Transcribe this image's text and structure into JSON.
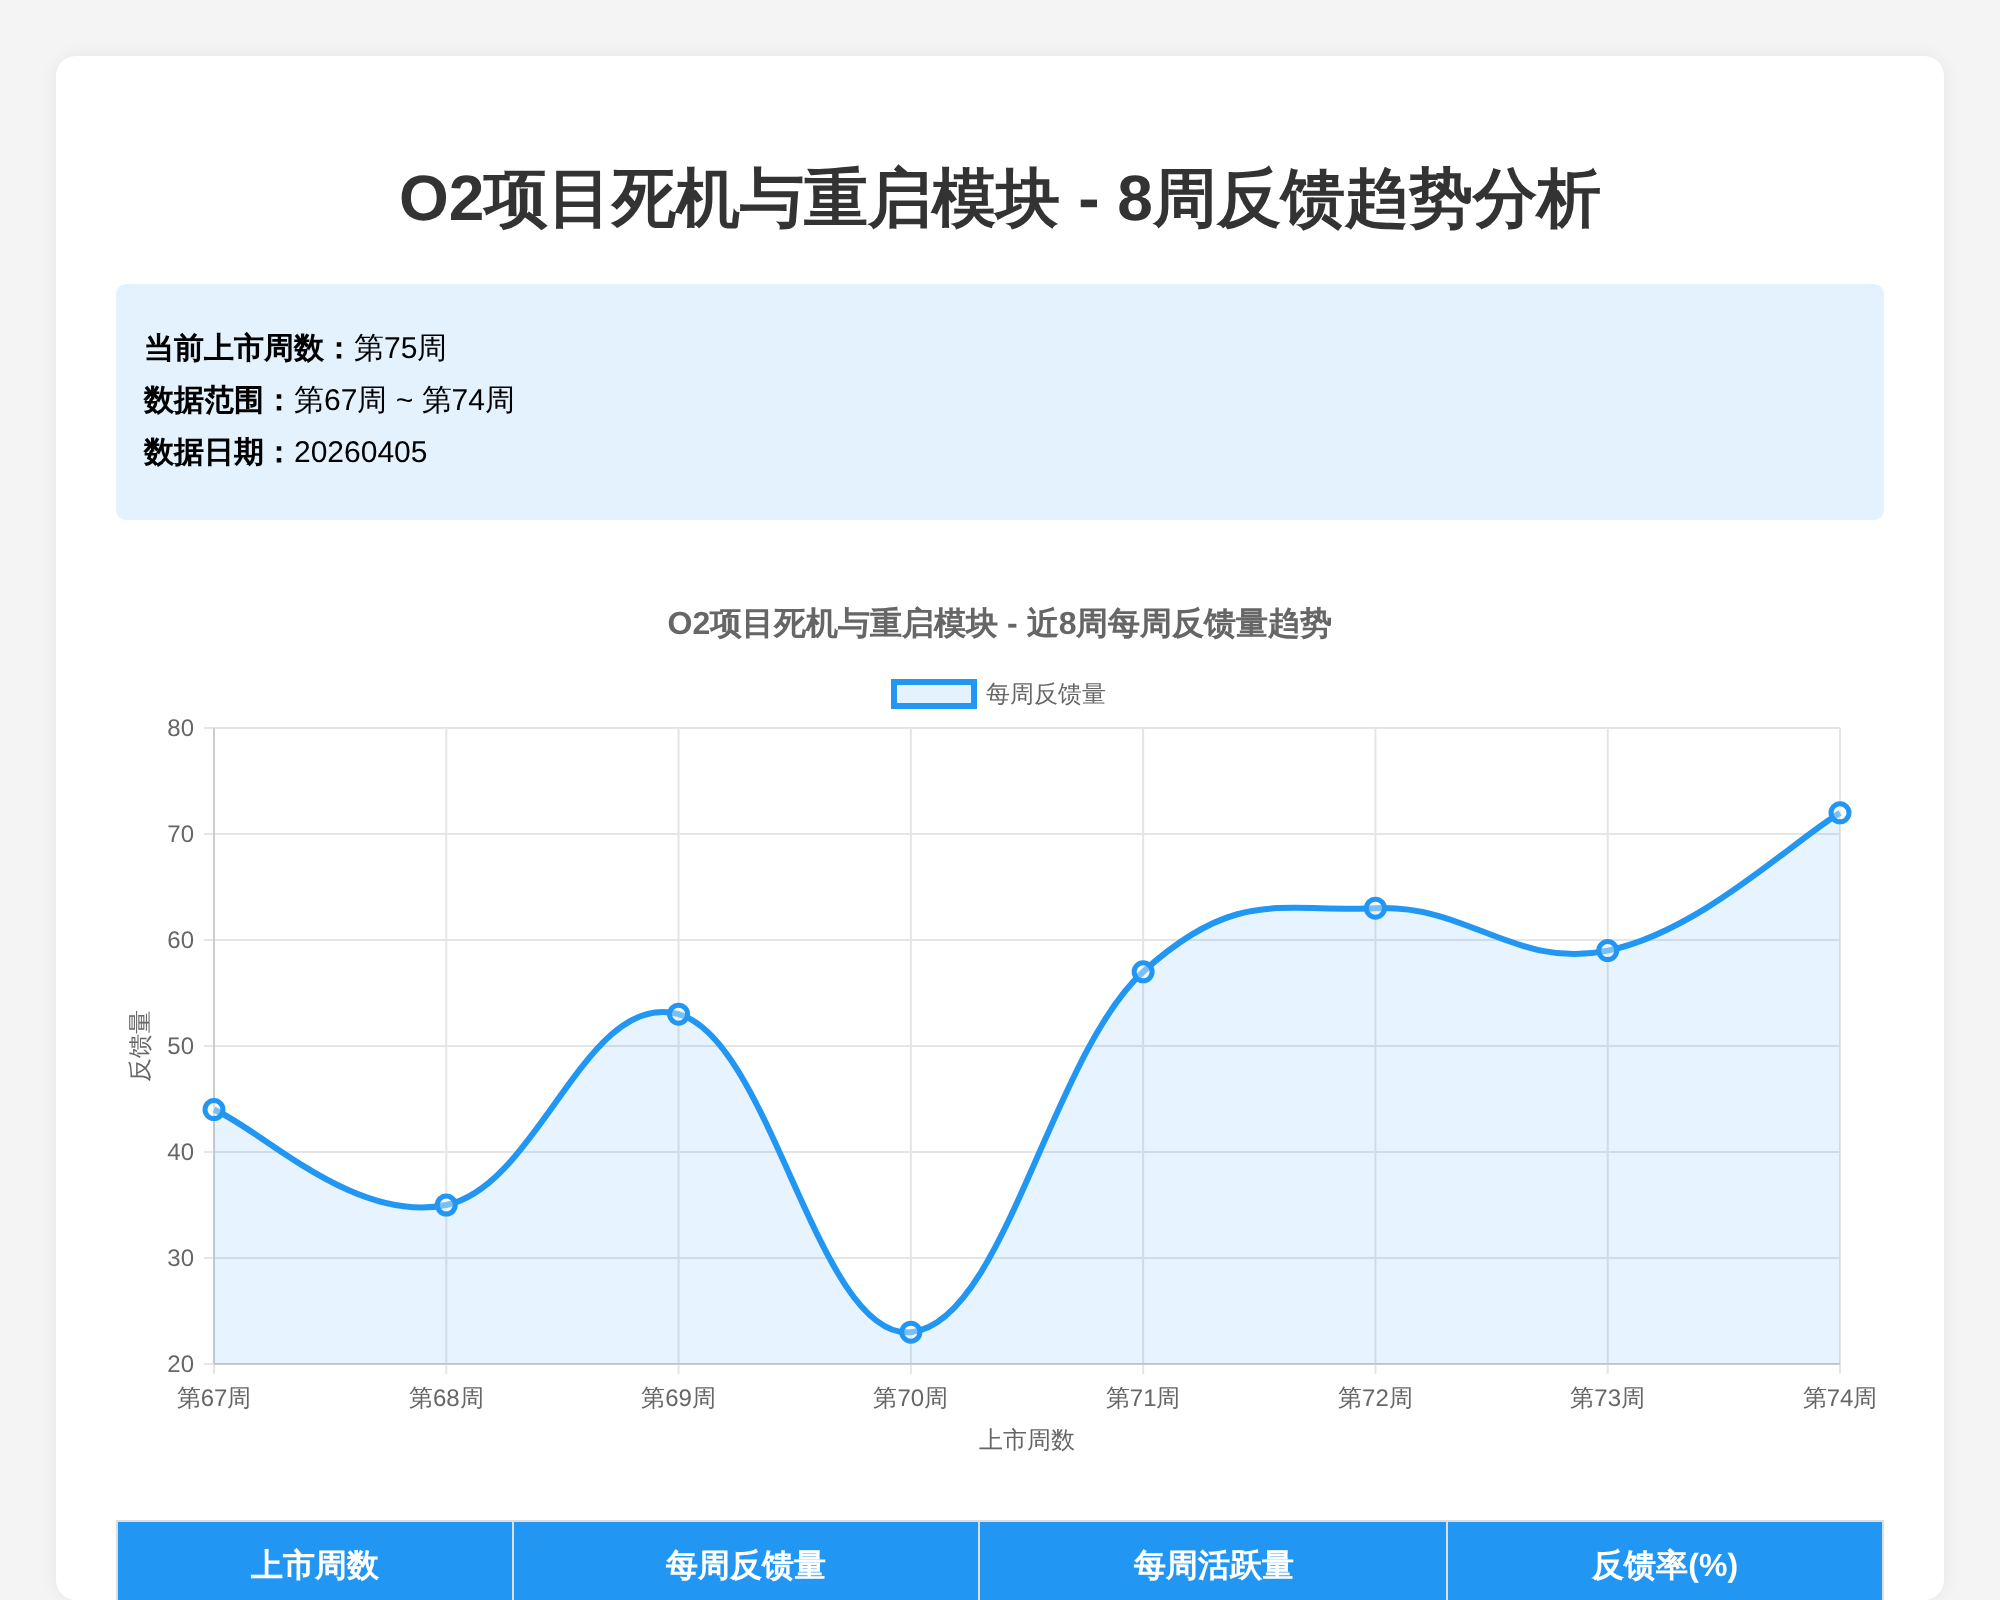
{
  "title": "O2项目死机与重启模块 - 8周反馈趋势分析",
  "info": [
    "**当前上市周数：**第75周",
    "**数据范围：**第67周 ~ 第74周",
    "**数据日期：**20260405"
  ],
  "chart": {
    "chart_data": {
      "type": "area",
      "title": "O2项目死机与重启模块 - 近8周每周反馈量趋势",
      "xlabel": "上市周数",
      "ylabel": "反馈量",
      "categories": [
        "第67周",
        "第68周",
        "第69周",
        "第70周",
        "第71周",
        "第72周",
        "第73周",
        "第74周"
      ],
      "series": [
        {
          "name": "每周反馈量",
          "color": "#2196f3",
          "values": [
            44,
            35,
            53,
            23,
            57,
            63,
            59,
            72
          ]
        }
      ],
      "ylim": [
        20,
        80
      ],
      "grid": true,
      "yticks": [
        20,
        30,
        40,
        50,
        60,
        70,
        80
      ]
    }
  },
  "table": {
    "columns": [
      "上市周数",
      "每周反馈量",
      "每周活跃量",
      "反馈率(%)"
    ]
  }
}
